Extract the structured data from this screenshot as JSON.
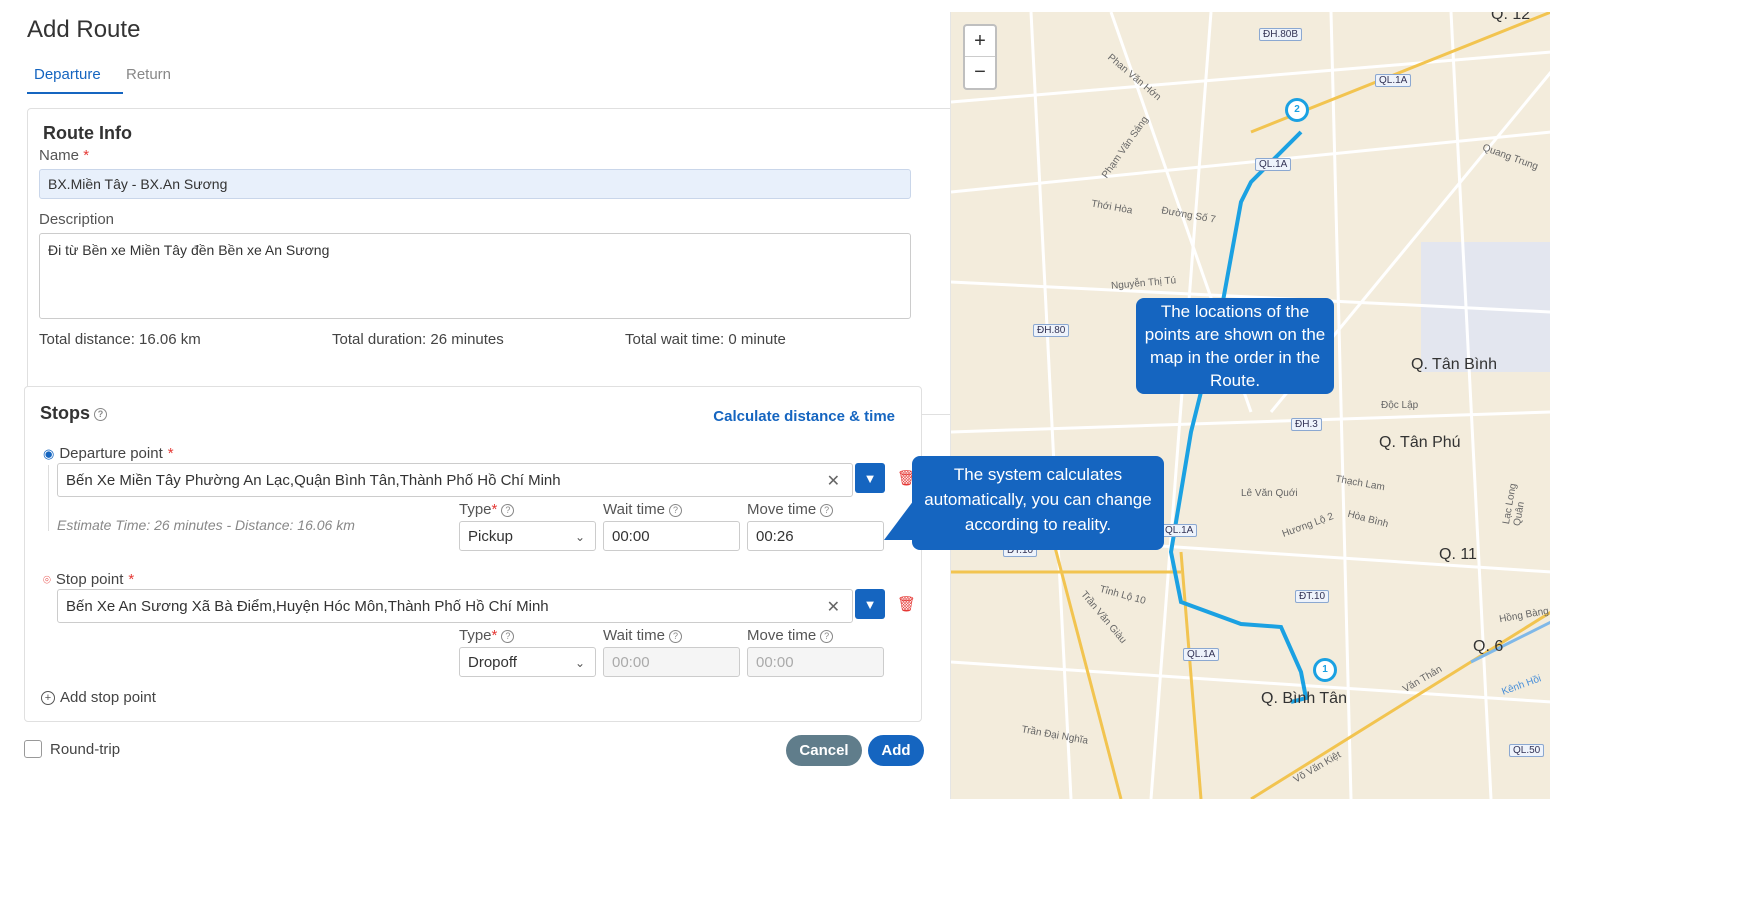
{
  "page": {
    "title": "Add Route",
    "tabs": [
      "Departure",
      "Return"
    ]
  },
  "route_info": {
    "title": "Route Info",
    "name_label": "Name",
    "name_value": "BX.Miền Tây - BX.An Sương",
    "description_label": "Description",
    "description_value": "Đi từ Bền xe Miền Tây đền Bền xe An Sương",
    "total_distance": "Total distance: 16.06 km",
    "total_duration": "Total duration: 26 minutes",
    "total_wait": "Total wait time: 0 minute"
  },
  "stops": {
    "title": "Stops",
    "calculate_link": "Calculate distance & time",
    "departure": {
      "label": "Departure point",
      "address": "Bến Xe Miền Tây Phường An Lạc,Quận Bình Tân,Thành Phố Hồ Chí Minh",
      "estimate": "Estimate Time: 26 minutes - Distance: 16.06 km",
      "type_label": "Type",
      "type_value": "Pickup",
      "wait_label": "Wait time",
      "wait_value": "00:00",
      "move_label": "Move time",
      "move_value": "00:26"
    },
    "stop": {
      "label": "Stop point",
      "address": "Bến Xe An Sương Xã Bà Điểm,Huyện Hóc Môn,Thành Phố Hồ Chí Minh",
      "type_label": "Type",
      "type_value": "Dropoff",
      "wait_label": "Wait time",
      "wait_value": "00:00",
      "move_label": "Move time",
      "move_value": "00:00"
    },
    "add_stop": "Add stop point"
  },
  "footer": {
    "round_trip": "Round-trip",
    "cancel": "Cancel",
    "add": "Add"
  },
  "callouts": {
    "system": "The system calculates automatically, you can change according to reality.",
    "map": "The locations of the points are shown on the map in the order in the Route."
  },
  "map": {
    "zoom_in": "+",
    "zoom_out": "−",
    "districts": [
      "Q. Tân Bình",
      "Q. Tân Phú",
      "Q. 11",
      "Q. 6",
      "Q. Bình Tân",
      "Q. 12"
    ],
    "road_badges": [
      "ĐH.80B",
      "QL.1A",
      "QL.1A",
      "ĐH.80",
      "ĐH.3",
      "QL.1A",
      "ĐT.10",
      "ĐT.10",
      "QL.1A",
      "QL.50"
    ],
    "street_names": [
      "Phan Văn Hớn",
      "Phạm Văn Sáng",
      "Quang Trung",
      "Thới Hòa",
      "Đường Số 7",
      "Nguyễn Thị Tú",
      "Độc Lập",
      "Thạch Lam",
      "Lê Văn Quới",
      "Hương Lộ 2",
      "Hòa Bình",
      "Tỉnh Lộ 10",
      "Trần Văn Giàu",
      "Trần Đại Nghĩa",
      "Võ Văn Kiệt",
      "Văn Thân",
      "Kênh Hồi",
      "Lạc Long Quân",
      "Hồng Bàng"
    ],
    "marker1": "1",
    "marker2": "2"
  }
}
